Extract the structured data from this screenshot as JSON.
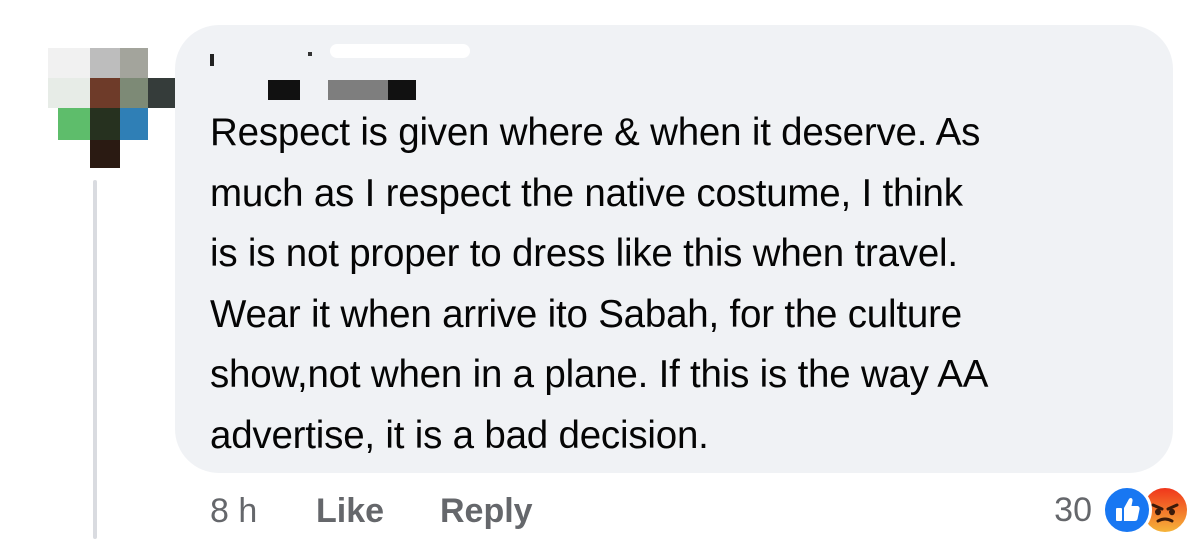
{
  "comment": {
    "text": "Respect is given where & when it deserve. As much as I respect the native costume, I think is is not proper to dress like this when travel. Wear it when arrive ito Sabah, for the culture show,not when in a plane. If this is the way AA advertise, it is a bad decision.",
    "lines": [
      "Respect is given where & when it deserve. As",
      "much as I respect the native costume, I think",
      "is is not proper to dress like this when travel.",
      "Wear it when arrive ito Sabah, for the culture",
      "show,not when in a plane. If this is the way AA",
      "advertise, it is a bad decision."
    ]
  },
  "actions": {
    "time": "8 h",
    "like_label": "Like",
    "reply_label": "Reply"
  },
  "reactions": {
    "count": "30",
    "types": [
      "like-icon",
      "angry-icon"
    ]
  },
  "colors": {
    "bubble": "#f0f2f5",
    "text": "#050505",
    "meta": "#65676b",
    "like_blue": "#1877f2"
  }
}
